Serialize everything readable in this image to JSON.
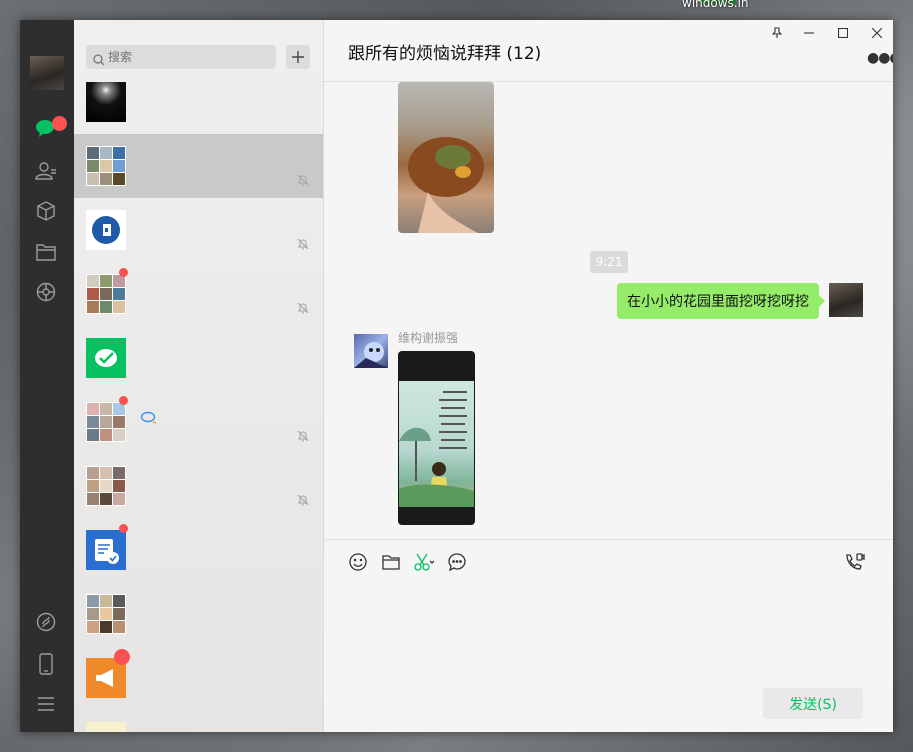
{
  "desktop": {
    "label": "windows.in"
  },
  "search": {
    "placeholder": "搜索"
  },
  "chat": {
    "title": "跟所有的烦恼说拜拜 (12)",
    "time_divider": "9:21",
    "my_message": "在小小的花园里面挖呀挖呀挖",
    "sender_name": "维构谢振强"
  },
  "send": {
    "label": "发送(S)"
  },
  "colors": {
    "accent": "#07c160",
    "bubble": "#95ec69",
    "badge": "#fa5151",
    "sidebar": "#2e2e2e"
  },
  "icons": [
    "chat-icon",
    "contacts-icon",
    "favorites-icon",
    "files-icon",
    "moments-icon",
    "mini-program-icon",
    "phone-icon",
    "menu-icon",
    "emoji-icon",
    "folder-icon",
    "scissors-icon",
    "chat-history-icon",
    "voice-call-icon",
    "mute-icon",
    "pin-icon",
    "minimize-icon",
    "maximize-icon",
    "close-icon"
  ]
}
